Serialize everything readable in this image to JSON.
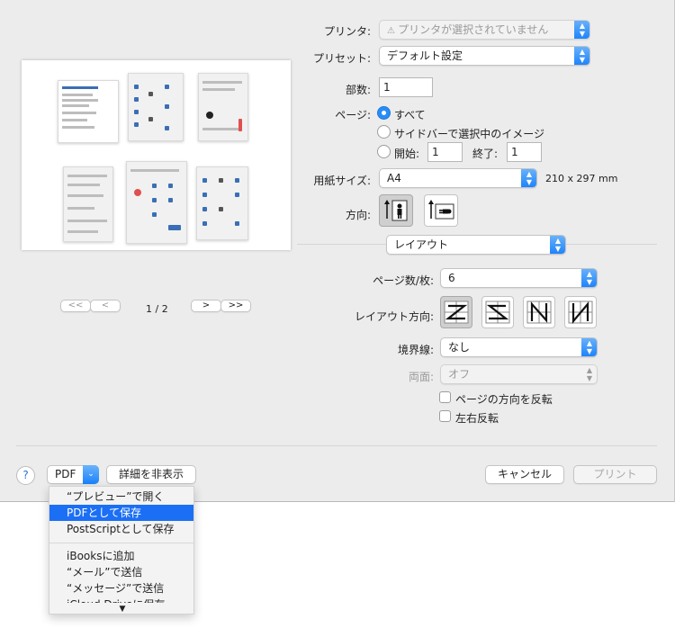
{
  "printer": {
    "label": "プリンタ:",
    "value": "プリンタが選択されていません",
    "warning_icon": "warning-icon"
  },
  "preset": {
    "label": "プリセット:",
    "value": "デフォルト設定"
  },
  "copies": {
    "label": "部数:",
    "value": "1"
  },
  "pages": {
    "label": "ページ:",
    "all": "すべて",
    "selection": "サイドバーで選択中のイメージ",
    "from_label": "開始:",
    "from_value": "1",
    "to_label": "終了:",
    "to_value": "1"
  },
  "paper": {
    "label": "用紙サイズ:",
    "value": "A4",
    "dims": "210 x 297 mm"
  },
  "orientation": {
    "label": "方向:"
  },
  "section": {
    "value": "レイアウト"
  },
  "layout": {
    "pages_per_sheet_label": "ページ数/枚:",
    "pages_per_sheet_value": "6",
    "direction_label": "レイアウト方向:",
    "border_label": "境界線:",
    "border_value": "なし",
    "two_sided_label": "両面:",
    "two_sided_value": "オフ",
    "reverse_orientation": "ページの方向を反転",
    "flip_horizontal": "左右反転"
  },
  "pager": {
    "first": "<<",
    "prev": "<",
    "next": ">",
    "last": ">>",
    "page_indicator": "1 / 2"
  },
  "bottom": {
    "help": "?",
    "pdf": "PDF",
    "hide_details": "詳細を非表示",
    "cancel": "キャンセル",
    "print": "プリント"
  },
  "pdf_menu": {
    "items": [
      "“プレビュー”で開く",
      "PDFとして保存",
      "PostScriptとして保存",
      "iBooksに追加",
      "“メール”で送信",
      "“メッセージ”で送信",
      "iCloud Driveに保存"
    ],
    "selected_index": 1
  }
}
